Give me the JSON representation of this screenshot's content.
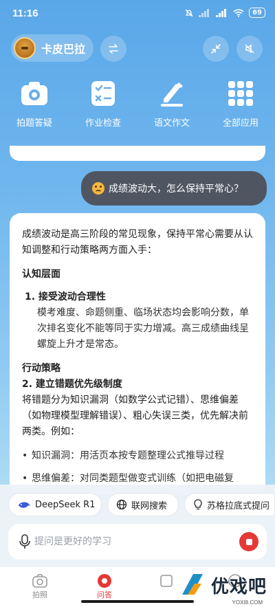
{
  "status_bar": {
    "time": "11:16",
    "battery": "69"
  },
  "profile": {
    "name": "卡皮巴拉"
  },
  "quick_actions": [
    {
      "label": "拍题答疑",
      "icon": "camera-icon"
    },
    {
      "label": "作业检查",
      "icon": "checklist-icon"
    },
    {
      "label": "语文作文",
      "icon": "pen-icon"
    },
    {
      "label": "全部应用",
      "icon": "grid-icon"
    }
  ],
  "chat": {
    "user_message": "成绩波动大，怎么保持平常心？",
    "answer": {
      "intro": "成绩波动是高三阶段的常见现象，保持平常心需要从认知调整和行动策略两方面入手：",
      "section1_title": "认知层面",
      "item1_title": "1. 接受波动合理性",
      "item1_body": "模考难度、命题侧重、临场状态均会影响分数，单次排名变化不能等同于实力增减。高三成绩曲线呈螺旋上升才是常态。",
      "section2_title": "行动策略",
      "item2_title": "2. 建立错题优先级制度",
      "item2_body": "将错题分为知识漏洞（如数学公式记错）、思维偏差（如物理模型理解错误）、粗心失误三类，优先解决前两类。例如：",
      "bullets": [
        "知识漏洞：用活页本按专题整理公式推导过程",
        "思维偏差：对同类题型做变式训练（如把电磁复"
      ]
    }
  },
  "composer": {
    "chips": [
      "DeepSeek R1",
      "联网搜索",
      "苏格拉底式提问"
    ],
    "placeholder": "提问是更好的学习"
  },
  "tabs": [
    {
      "label": "拍照",
      "active": false
    },
    {
      "label": "问答",
      "active": true
    },
    {
      "label": "",
      "active": false
    },
    {
      "label": "",
      "active": false
    }
  ],
  "watermark": {
    "text": "优戏吧",
    "sub": "YOXI8.COM"
  },
  "colors": {
    "accent": "#e53935",
    "bubble": "#4f5661",
    "sky": "#6fb6ee"
  }
}
